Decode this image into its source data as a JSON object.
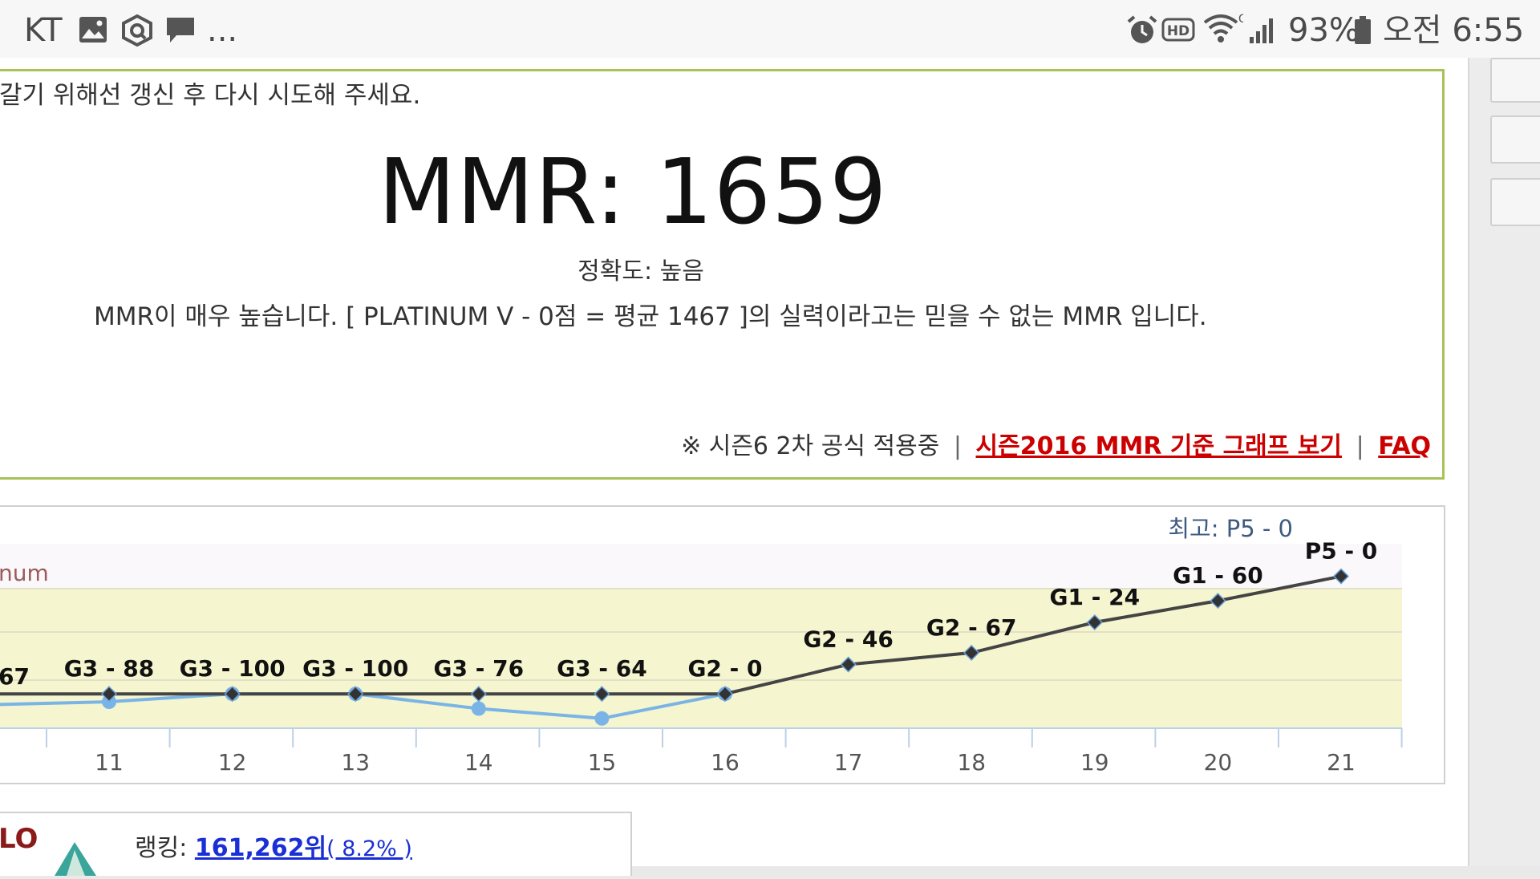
{
  "status_bar": {
    "carrier": "KT",
    "more": "...",
    "battery": "93%",
    "time": "오전 6:55",
    "icons": [
      "gallery-icon",
      "q-app-icon",
      "message-icon",
      "alarm-icon",
      "hd-voice-icon",
      "wifi-icon",
      "signal-icon",
      "battery-icon"
    ]
  },
  "mmr": {
    "notice": "갈기 위해선 갱신 후 다시 시도해 주세요.",
    "value_text": "MMR: 1659",
    "accuracy": "정확도: 높음",
    "description": "MMR이 매우 높습니다. [ PLATINUM V - 0점 = 평균 1467 ]의 실력이라고는 믿을 수 없는 MMR 입니다.",
    "season_note": "※ 시즌6 2차 공식 적용중",
    "separator": "|",
    "graph_link": "시즌2016 MMR 기준 그래프 보기",
    "faq_link": "FAQ",
    "link_color": "#cc0000",
    "border_color": "#a7c257"
  },
  "chart_data": {
    "type": "line",
    "best_label": "최고: P5 - 0",
    "tier_band_label": "num",
    "x": [
      11,
      12,
      13,
      14,
      15,
      16,
      17,
      18,
      19,
      20,
      21
    ],
    "left_cut_label": "67",
    "series": [
      {
        "color": "#444444",
        "labels": [
          "G3 - 88",
          "G3 - 100",
          "G3 - 100",
          "G3 - 76",
          "G3 - 64",
          "G2 - 0",
          "G2 - 46",
          "G2 - 67",
          "G1 - 24",
          "G1 - 60",
          "P5 - 0"
        ],
        "values": [
          1595,
          1595,
          1595,
          1595,
          1595,
          1595,
          1625,
          1637,
          1668,
          1690,
          1715
        ]
      },
      {
        "color": "#7ab4e6",
        "values": [
          1587,
          1595,
          1595,
          1580,
          1570,
          1595
        ]
      }
    ],
    "band_color": "#f5f5cf"
  },
  "ranking": {
    "label": "랭킹:",
    "value": "161,262위",
    "percent": "( 8.2% )",
    "tier_partial": "LO"
  }
}
